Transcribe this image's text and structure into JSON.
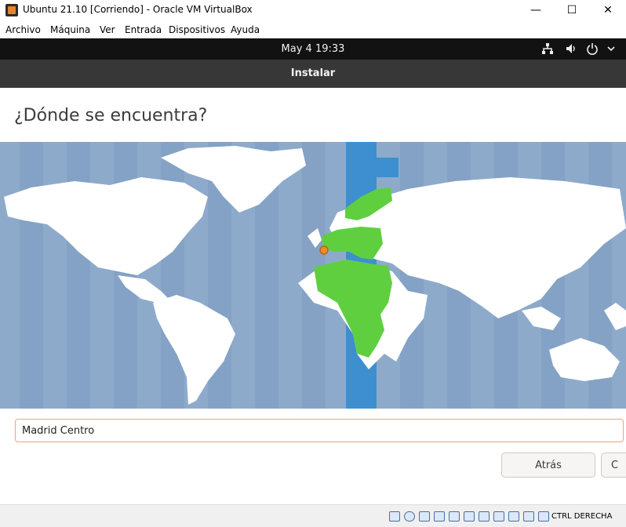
{
  "window": {
    "title": "Ubuntu 21.10 [Corriendo] - Oracle VM VirtualBox",
    "minimize_glyph": "—",
    "maximize_glyph": "☐",
    "close_glyph": "✕"
  },
  "menubar": {
    "items": [
      "Archivo",
      "Máquina",
      "Ver",
      "Entrada",
      "Dispositivos",
      "Ayuda"
    ]
  },
  "topbar": {
    "clock": "May 4  19:33",
    "tray_icons": [
      "network-icon",
      "volume-icon",
      "power-icon",
      "chevron-down-icon"
    ]
  },
  "installer": {
    "header_title": "Instalar",
    "question": "¿Dónde se encuentra?",
    "map": {
      "highlight_color": "#5fcf3f",
      "ocean_color": "#8eaacb",
      "selected_zone_color": "#3d8fcf",
      "selected_marker_color": "#f08a24"
    },
    "timezone_input": {
      "value": "Madrid Centro"
    },
    "buttons": {
      "back_label": "Atrás",
      "continue_label": "C"
    }
  },
  "statusbar": {
    "host_key": "CTRL DERECHA",
    "icons": [
      "hard-disk-icon",
      "optical-drive-icon",
      "audio-icon",
      "network-adapter-icon",
      "usb-icon",
      "shared-folder-icon",
      "display-icon",
      "video-capture-icon",
      "cpu-icon",
      "mouse-integration-icon",
      "keyboard-icon"
    ]
  }
}
